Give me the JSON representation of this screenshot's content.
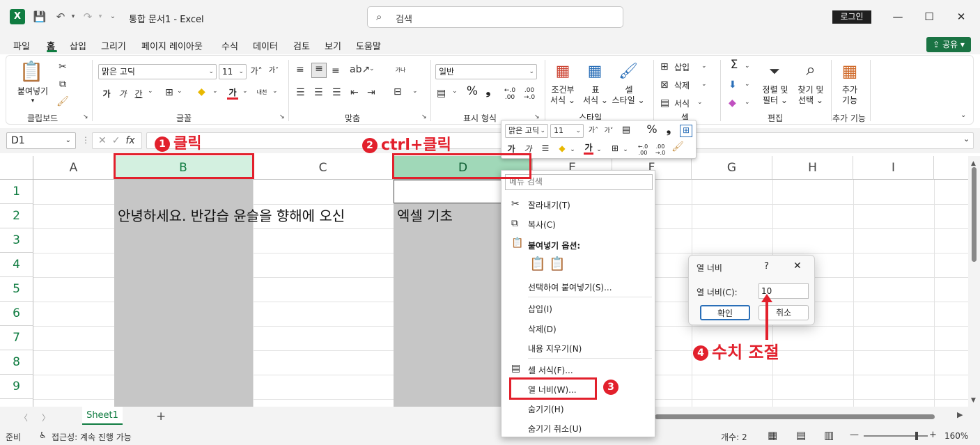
{
  "titlebar": {
    "app_icon": "X",
    "doc_title": "통합 문서1  -  Excel",
    "search_placeholder": "검색",
    "login_label": "로그인"
  },
  "menu": {
    "tabs": [
      "파일",
      "홈",
      "삽입",
      "그리기",
      "페이지 레이아웃",
      "수식",
      "데이터",
      "검토",
      "보기",
      "도움말"
    ],
    "share_label": "공유"
  },
  "ribbon": {
    "clipboard": {
      "paste_label": "붙여넣기",
      "group_label": "클립보드"
    },
    "font": {
      "font_name": "맑은 고딕",
      "font_size": "11",
      "group_label": "글꼴",
      "bold": "가",
      "italic": "가",
      "underline": "간",
      "font_color": "가",
      "phonetic": "내천"
    },
    "alignment": {
      "group_label": "맞춤",
      "wrap": "가나"
    },
    "number": {
      "format": "일반",
      "group_label": "표시 형식",
      "percent": "%",
      "comma": "❟"
    },
    "styles": {
      "conditional_label": "조건부",
      "conditional_label2": "서식",
      "table_label": "표",
      "table_label2": "서식",
      "cell_style_label": "셀",
      "cell_style_label2": "스타일",
      "group_label": "스타일"
    },
    "cells": {
      "insert": "삽입",
      "delete": "삭제",
      "format": "서식",
      "group_label": "셀"
    },
    "editing": {
      "sum": "Σ",
      "sort_label": "정렬 및",
      "sort_label2": "필터",
      "find_label": "찾기 및",
      "find_label2": "선택",
      "group_label": "편집"
    },
    "addins": {
      "label": "추가",
      "label2": "기능",
      "group_label": "추가 기능"
    }
  },
  "formulabar": {
    "name_box": "D1",
    "fx": "fx"
  },
  "columns": [
    "A",
    "B",
    "C",
    "D",
    "E",
    "F",
    "G",
    "H",
    "I"
  ],
  "rows": [
    "1",
    "2",
    "3",
    "4",
    "5",
    "6",
    "7",
    "8",
    "9"
  ],
  "cells": {
    "b2": "안녕하세요. 반갑습 윤슬을 향해에 오신",
    "d2": "엑셀 기초"
  },
  "sheets": {
    "tab": "Sheet1",
    "add": "+"
  },
  "status": {
    "ready": "준비",
    "accessibility": "접근성: 계속 진행 가능",
    "count": "개수: 2",
    "zoom": "160%"
  },
  "mini_toolbar": {
    "font": "맑은 고딕",
    "size": "11",
    "percent": "%",
    "comma": "❟",
    "bold": "가",
    "italic": "가",
    "font_color": "가"
  },
  "context_menu": {
    "search_placeholder": "메뉴 검색",
    "cut": "잘라내기(T)",
    "copy": "복사(C)",
    "paste_options": "붙여넣기 옵션:",
    "paste_special": "선택하여 붙여넣기(S)...",
    "insert": "삽입(I)",
    "delete": "삭제(D)",
    "clear": "내용 지우기(N)",
    "format_cells": "셀 서식(F)...",
    "col_width": "열 너비(W)...",
    "hide": "숨기기(H)",
    "unhide": "숨기기 취소(U)"
  },
  "dialog": {
    "title": "열 너비",
    "help": "?",
    "close": "✕",
    "field_label": "열 너비(C):",
    "field_value": "10",
    "ok": "확인",
    "cancel": "취소"
  },
  "annotations": {
    "step1": "클릭",
    "step1_num": "1",
    "step2": "ctrl+클릭",
    "step2_num": "2",
    "step3_num": "3",
    "step4": "수치 조절",
    "step4_num": "4"
  },
  "colors": {
    "excel_green": "#107c41",
    "annotation_red": "#e2202c",
    "selection_gray": "#c6c6c6"
  }
}
